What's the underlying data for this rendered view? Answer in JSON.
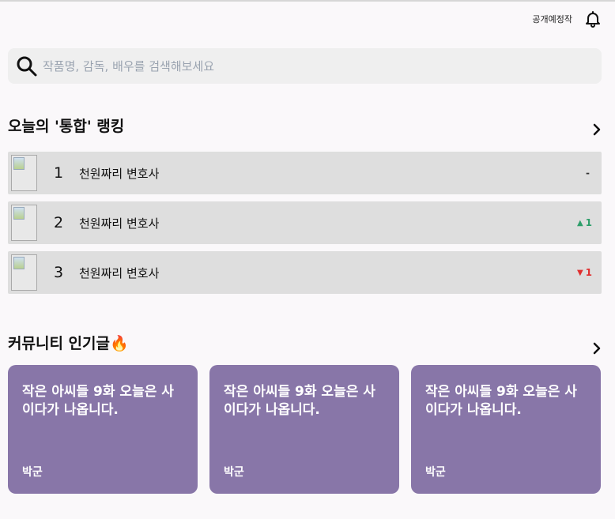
{
  "topbar": {
    "upcoming_label": "공개예정작",
    "bell_icon": "bell-icon"
  },
  "search": {
    "placeholder": "작품명, 감독, 배우를 검색해보세요",
    "icon": "search-icon"
  },
  "ranking": {
    "title": "오늘의 '통합' 랭킹",
    "more_icon": "chevron-right-icon",
    "items": [
      {
        "rank": "1",
        "title": "천원짜리 변호사",
        "change_symbol": "-",
        "change_value": "",
        "change_color": "#333333"
      },
      {
        "rank": "2",
        "title": "천원짜리 변호사",
        "change_symbol": "▲",
        "change_value": "1",
        "change_color": "#2e9e6a"
      },
      {
        "rank": "3",
        "title": "천원짜리 변호사",
        "change_symbol": "▼",
        "change_value": "1",
        "change_color": "#e03030"
      }
    ]
  },
  "community": {
    "title": "커뮤니티 인기글🔥",
    "more_icon": "chevron-right-icon",
    "posts": [
      {
        "title": "작은 아씨들 9화 오늘은 사이다가 나옵니다.",
        "author": "박군"
      },
      {
        "title": "작은 아씨들 9화 오늘은 사이다가 나옵니다.",
        "author": "박군"
      },
      {
        "title": "작은 아씨들 9화 오늘은 사이다가 나옵니다.",
        "author": "박군"
      }
    ],
    "card_color": "#8876a8"
  }
}
